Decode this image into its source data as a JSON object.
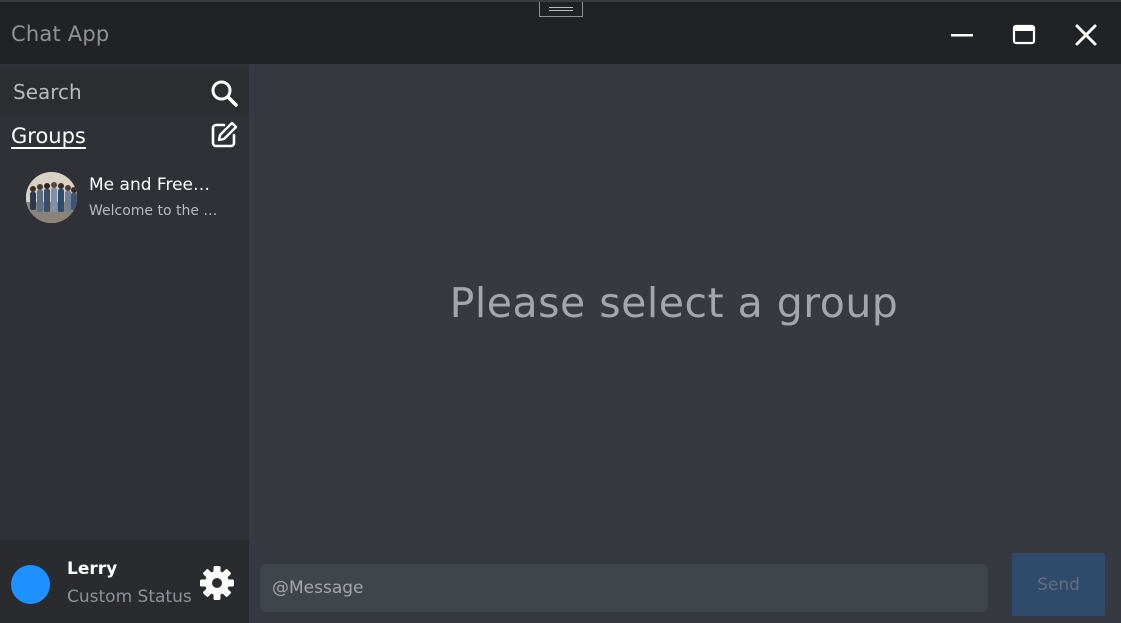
{
  "window": {
    "title": "Chat App",
    "controls": {
      "minimize": "minimize-icon",
      "maximize": "maximize-icon",
      "close": "close-icon"
    }
  },
  "sidebar": {
    "search": {
      "placeholder": "Search",
      "icon": "search-icon"
    },
    "groups": {
      "title": "Groups",
      "compose_icon": "compose-icon",
      "items": [
        {
          "name": "Me and Freeman",
          "preview": "Welcome to the group",
          "avatar": "group-photo"
        }
      ]
    },
    "user": {
      "name": "Lerry",
      "status": "Custom Status",
      "avatar_color": "#1e90ff",
      "settings_icon": "gear-icon"
    }
  },
  "main": {
    "empty_state": "Please select a group",
    "composer": {
      "placeholder": "@Message",
      "value": "",
      "send_label": "Send"
    }
  },
  "colors": {
    "titlebar": "#202225",
    "sidebar": "#2f3136",
    "main": "#36393f",
    "input": "#40444b",
    "send_button": "#2f4a6b",
    "user_avatar": "#1e90ff"
  }
}
